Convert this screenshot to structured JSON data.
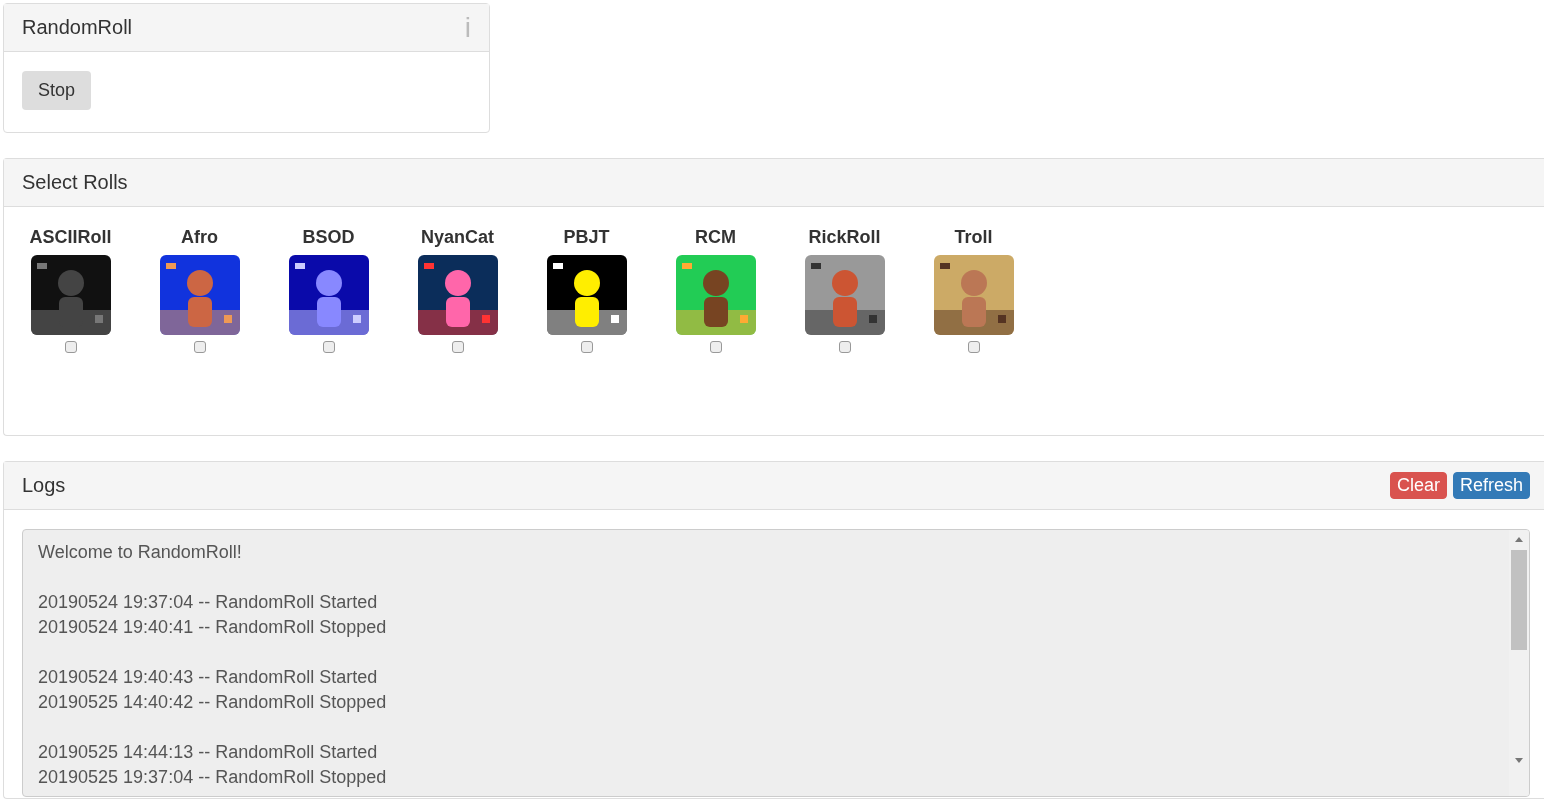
{
  "app_panel": {
    "title": "RandomRoll",
    "info_glyph": "i",
    "stop_button": "Stop"
  },
  "rolls_panel": {
    "title": "Select Rolls",
    "rolls": [
      {
        "label": "ASCIIRoll",
        "checked": false
      },
      {
        "label": "Afro",
        "checked": false
      },
      {
        "label": "BSOD",
        "checked": false
      },
      {
        "label": "NyanCat",
        "checked": false
      },
      {
        "label": "PBJT",
        "checked": false
      },
      {
        "label": "RCM",
        "checked": false
      },
      {
        "label": "RickRoll",
        "checked": false
      },
      {
        "label": "Troll",
        "checked": false
      }
    ]
  },
  "logs_panel": {
    "title": "Logs",
    "clear_button": "Clear",
    "refresh_button": "Refresh",
    "log_groups": [
      [
        "Welcome to RandomRoll!"
      ],
      [
        "20190524 19:37:04 -- RandomRoll Started",
        "20190524 19:40:41 -- RandomRoll Stopped"
      ],
      [
        "20190524 19:40:43 -- RandomRoll Started",
        "20190525 14:40:42 -- RandomRoll Stopped"
      ],
      [
        "20190525 14:44:13 -- RandomRoll Started",
        "20190525 19:37:04 -- RandomRoll Stopped"
      ]
    ]
  }
}
